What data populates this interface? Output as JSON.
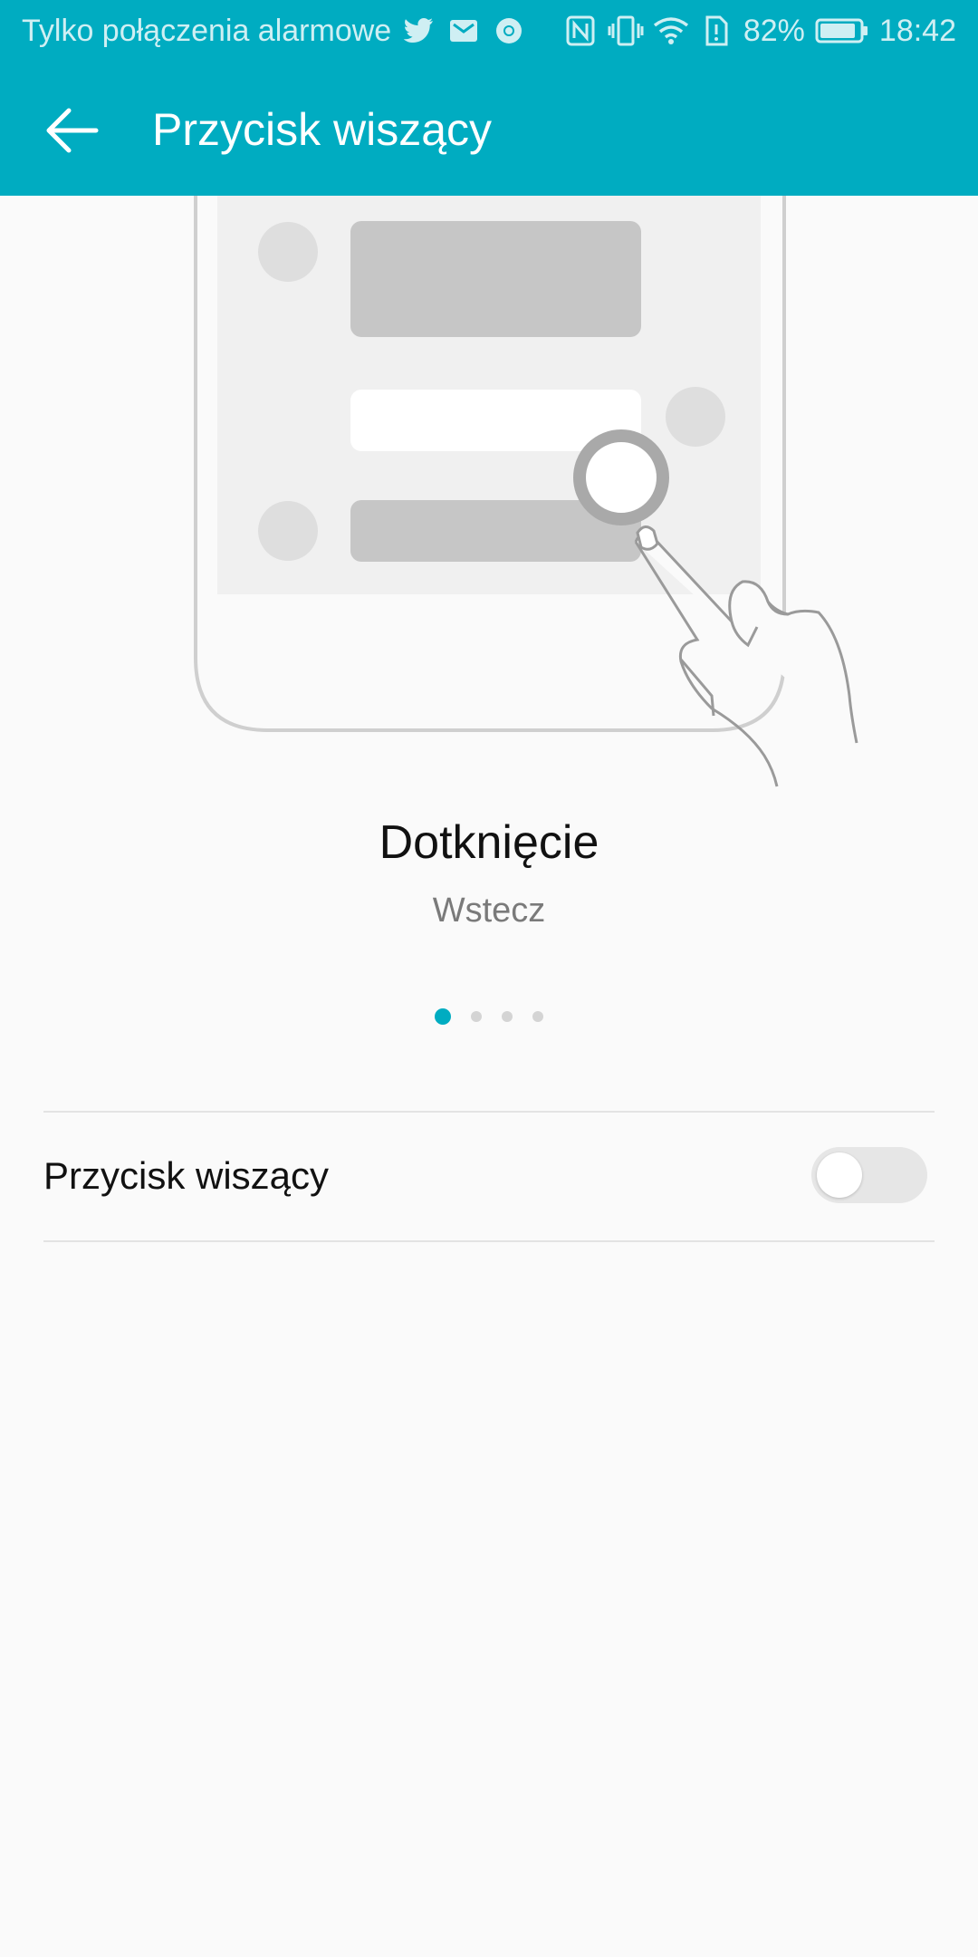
{
  "status_bar": {
    "carrier_text": "Tylko połączenia alarmowe",
    "battery_percent": "82%",
    "time": "18:42",
    "icons": [
      "twitter-icon",
      "mail-icon",
      "chrome-icon",
      "nfc-icon",
      "vibrate-icon",
      "wifi-icon",
      "sim-alert-icon",
      "battery-icon"
    ]
  },
  "toolbar": {
    "title": "Przycisk wiszący",
    "back_icon": "arrow-left-icon"
  },
  "tutorial": {
    "title": "Dotknięcie",
    "subtitle": "Wstecz",
    "pages_total": 4,
    "current_page": 1
  },
  "setting": {
    "label": "Przycisk wiszący",
    "enabled": false
  },
  "colors": {
    "accent": "#00acc1",
    "background": "#fafafa",
    "divider": "#e3e3e3"
  }
}
